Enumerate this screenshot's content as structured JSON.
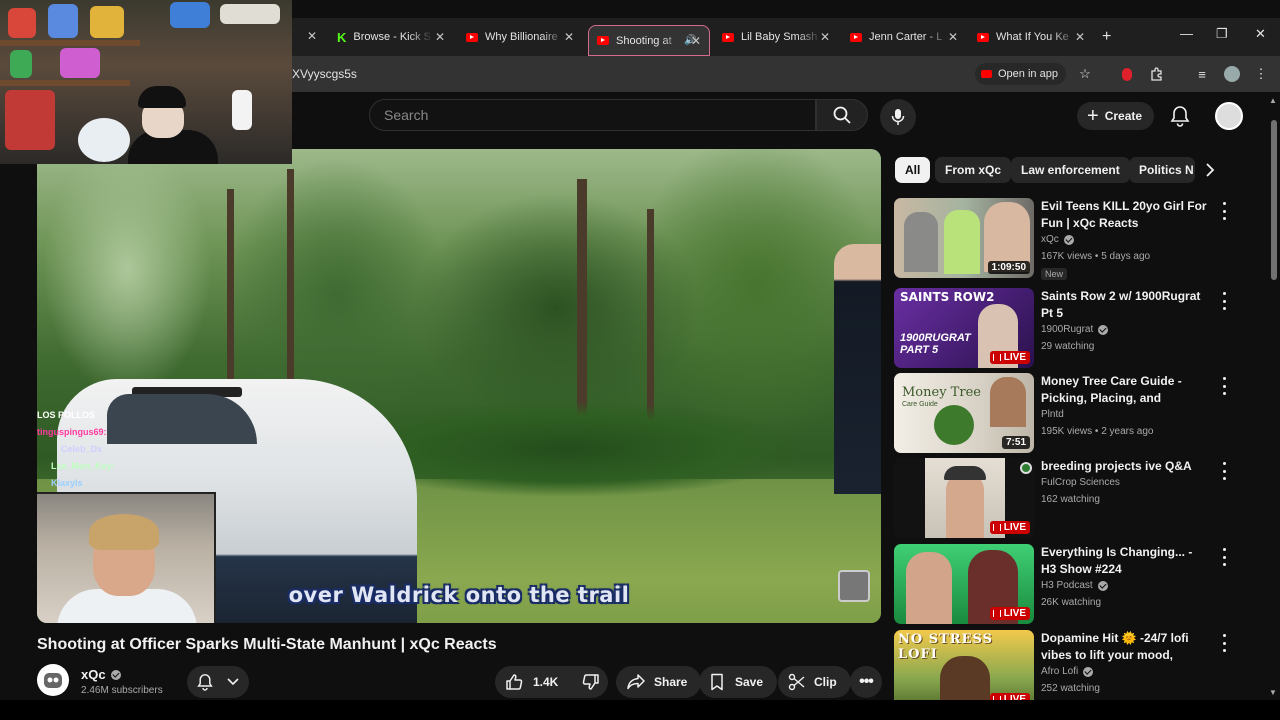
{
  "browser": {
    "tabs": [
      {
        "label": "Browse - Kick S",
        "icon": "kick-logo"
      },
      {
        "label": "Why Billionaire",
        "icon": "youtube-icon"
      },
      {
        "label": "Shooting at",
        "icon": "youtube-icon",
        "active": true
      },
      {
        "label": "Lil Baby Smash",
        "icon": "youtube-icon"
      },
      {
        "label": "Jenn Carter - L",
        "icon": "youtube-icon"
      },
      {
        "label": "What If You Ke",
        "icon": "youtube-icon"
      }
    ],
    "url": "XVyyscgs5s",
    "open_in_app": "Open in app"
  },
  "header": {
    "search_placeholder": "Search",
    "create_label": "Create"
  },
  "player": {
    "subtitle": "over Waldrick onto the trail",
    "chat_overlay": [
      {
        "user": "LOS POLLOS",
        "color": "#ffffff"
      },
      {
        "user": "tinguspingus69:",
        "color": "#ff3aa0"
      },
      {
        "user": "Celeb_Dx",
        "color": "#d0d0ff"
      },
      {
        "user": "Lse_Mon_Key:",
        "color": "#c0ffc0"
      },
      {
        "user": "Klaxyls",
        "color": "#9ad0ff"
      }
    ]
  },
  "video": {
    "title": "Shooting at Officer Sparks Multi-State Manhunt | xQc Reacts",
    "channel": "xQc",
    "subscribers": "2.46M subscribers",
    "likes": "1.4K",
    "share_label": "Share",
    "save_label": "Save",
    "clip_label": "Clip"
  },
  "chips": [
    "All",
    "From xQc",
    "Law enforcement",
    "Politics N"
  ],
  "recommendations": [
    {
      "title": "Evil Teens KILL 20yo Girl For Fun | xQc Reacts",
      "channel": "xQc",
      "verified": true,
      "meta": "167K views • 5 days ago",
      "duration": "1:09:50",
      "badge": "New",
      "thumb_colors": [
        "#c9b8a2",
        "#6e6a66"
      ]
    },
    {
      "title": "Saints Row 2 w/ 1900Rugrat Pt 5",
      "channel": "1900Rugrat",
      "verified": true,
      "meta": "29 watching",
      "live": "LIVE",
      "thumb_text": "SAINTS ROW2",
      "thumb_text2": "1900RUGRAT PART 5",
      "thumb_colors": [
        "#5b2a8a",
        "#2a114d"
      ]
    },
    {
      "title": "Money Tree Care Guide - Picking, Placing, and Parentin...",
      "channel": "Plntd",
      "verified": false,
      "meta": "195K views • 2 years ago",
      "duration": "7:51",
      "thumb_text": "Money Tree",
      "thumb_text2": "Care Guide",
      "thumb_colors": [
        "#f3eee6",
        "#c8c2b6"
      ]
    },
    {
      "title": "breeding projects ive Q&A",
      "channel": "FulCrop Sciences",
      "verified": false,
      "meta": "162 watching",
      "live": "LIVE",
      "thumb_colors": [
        "#d8d2c8",
        "#121212"
      ]
    },
    {
      "title": "Everything Is Changing... - H3 Show #224",
      "channel": "H3 Podcast",
      "verified": true,
      "meta": "26K watching",
      "live": "LIVE",
      "thumb_colors": [
        "#37c76b",
        "#1a8a3e"
      ]
    },
    {
      "title": "Dopamine Hit 🌞 -24/7 lofi vibes to lift your mood, stress ...",
      "channel": "Afro Lofi",
      "verified": true,
      "meta": "252 watching",
      "live": "LIVE",
      "thumb_text": "NO STRESS LOFI",
      "thumb_colors": [
        "#f2c94c",
        "#6a8a2a"
      ]
    }
  ],
  "colors": {
    "youtube_red": "#ff0000",
    "live_red": "#cc0000",
    "active_tab_border": "#d46a8f",
    "kick_green": "#53fc18"
  }
}
